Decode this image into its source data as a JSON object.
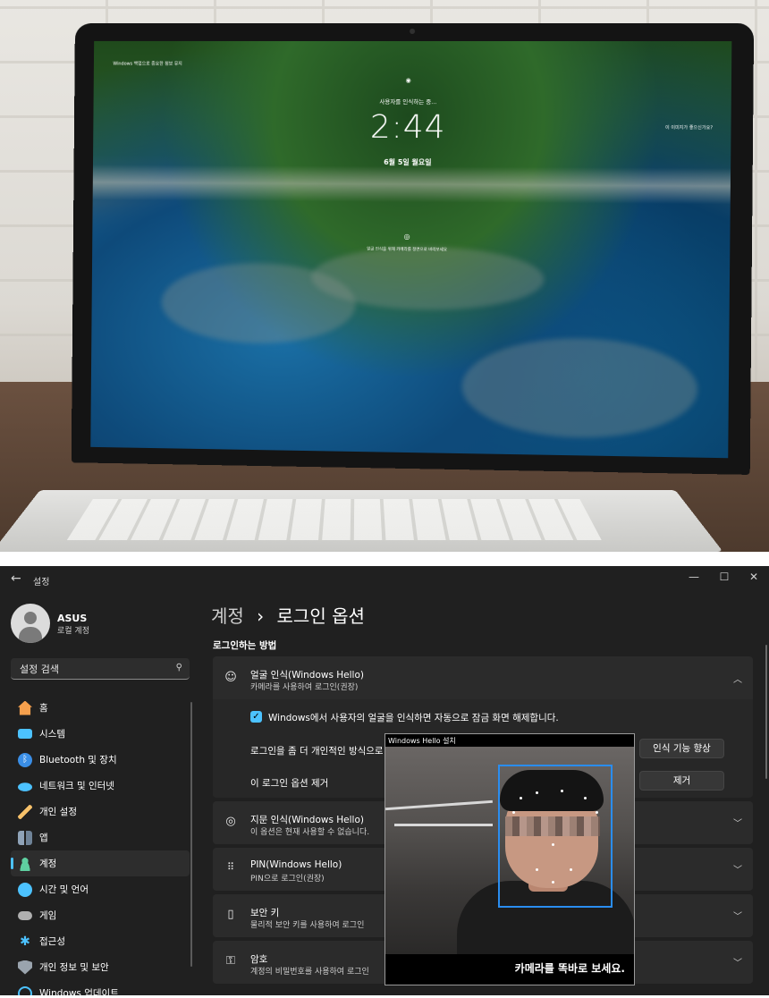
{
  "lockscreen": {
    "top_left_text": "Windows 백업으로 중요한 정보 유지",
    "status_text": "사용자를 인식하는 중...",
    "time": "2:44",
    "date": "6월 5일 월요일",
    "center_hint": "얼굴 인식을 위해 카메라를 정면으로 바라보세요",
    "top_right_text": "이 이미지가 좋으신가요?"
  },
  "window": {
    "title": "설정",
    "back_glyph": "←",
    "minimize_glyph": "—",
    "maximize_glyph": "☐",
    "close_glyph": "✕"
  },
  "profile": {
    "name": "ASUS",
    "account_type": "로컬 계정"
  },
  "search": {
    "placeholder": "설정 검색"
  },
  "sidebar": {
    "items": [
      {
        "label": "홈",
        "icon": "home-icon",
        "color": "#f6a04d"
      },
      {
        "label": "시스템",
        "icon": "system-icon",
        "color": "#4cc2ff"
      },
      {
        "label": "Bluetooth 및 장치",
        "icon": "bluetooth-icon",
        "color": "#3a8ee6"
      },
      {
        "label": "네트워크 및 인터넷",
        "icon": "wifi-icon",
        "color": "#4cc2ff"
      },
      {
        "label": "개인 설정",
        "icon": "brush-icon",
        "color": "#f7c16a"
      },
      {
        "label": "앱",
        "icon": "apps-icon",
        "color": "#8fa3b8"
      },
      {
        "label": "계정",
        "icon": "account-icon",
        "color": "#5fd0a0"
      },
      {
        "label": "시간 및 언어",
        "icon": "globe-icon",
        "color": "#4cc2ff"
      },
      {
        "label": "게임",
        "icon": "gamepad-icon",
        "color": "#b0b0b0"
      },
      {
        "label": "접근성",
        "icon": "accessibility-icon",
        "color": "#4cc2ff"
      },
      {
        "label": "개인 정보 및 보안",
        "icon": "shield-icon",
        "color": "#9aa4ae"
      },
      {
        "label": "Windows 업데이트",
        "icon": "update-icon",
        "color": "#4cc2ff"
      }
    ]
  },
  "breadcrumb": {
    "parent": "계정",
    "separator": "›",
    "current": "로그인 옵션"
  },
  "section": {
    "title": "로그인하는 방법"
  },
  "face": {
    "title": "얼굴 인식(Windows Hello)",
    "subtitle": "카메라를 사용하여 로그인(권장)",
    "checkbox_label": "Windows에서 사용자의 얼굴을 인식하면 자동으로 잠금 화면 해제합니다.",
    "improve_label": "로그인을 좀 더 개인적인 방식으로",
    "improve_button": "인식 기능 향상",
    "remove_label": "이 로그인 옵션 제거",
    "remove_button": "제거"
  },
  "fingerprint": {
    "title": "지문 인식(Windows Hello)",
    "subtitle": "이 옵션은 현재 사용할 수 없습니다."
  },
  "pin": {
    "title": "PIN(Windows Hello)",
    "subtitle": "PIN으로 로그인(권장)"
  },
  "security_key": {
    "title": "보안 키",
    "subtitle": "물리적 보안 키를 사용하여 로그인"
  },
  "password": {
    "title": "암호",
    "subtitle": "계정의 비밀번호를 사용하여 로그인"
  },
  "hello_popup": {
    "title": "Windows Hello 설치",
    "message": "카메라를 똑바로 보세요."
  },
  "colors": {
    "accent": "#4cc2ff",
    "face_box": "#2a8df0",
    "window_bg": "#202020",
    "card_bg": "#2b2b2b"
  }
}
